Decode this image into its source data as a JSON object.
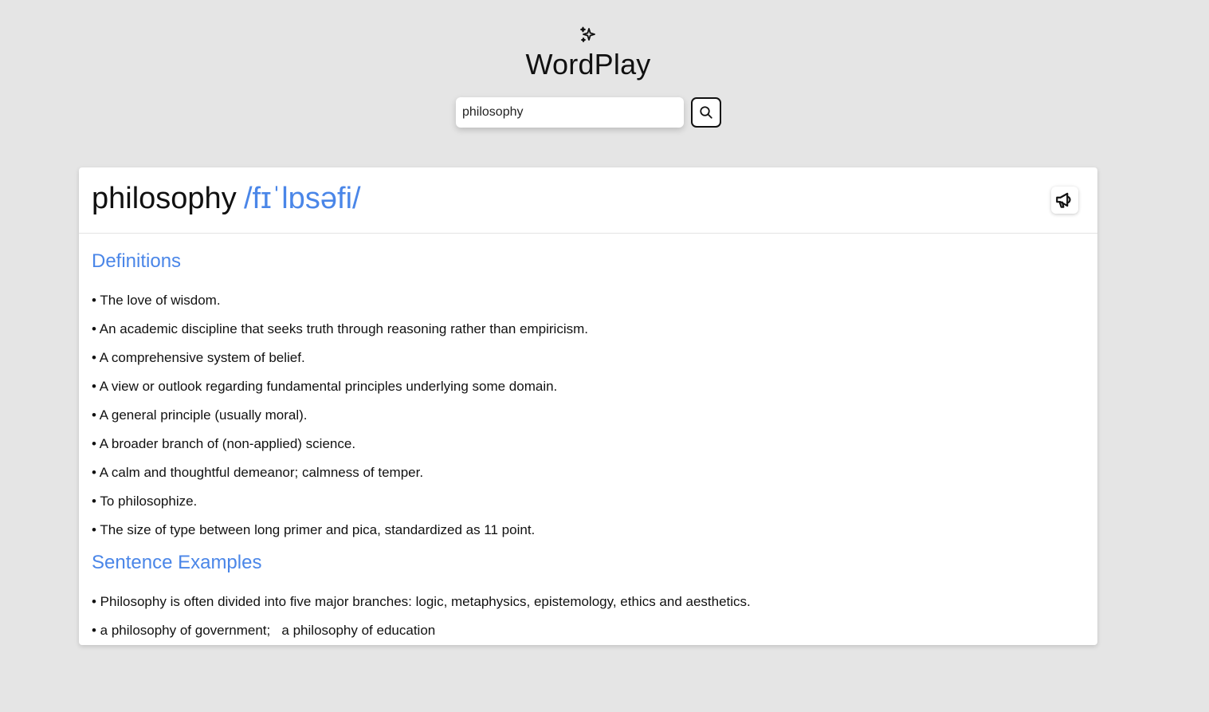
{
  "app": {
    "title": "WordPlay",
    "logo_icon": "sparkles-icon"
  },
  "search": {
    "value": "philosophy",
    "button_icon": "search-icon"
  },
  "entry": {
    "word": "philosophy",
    "phonetic": "/fɪˈlɒsəfi/",
    "audio_icon": "megaphone-icon",
    "definitions_heading": "Definitions",
    "definitions": [
      "• The love of wisdom.",
      "• An academic discipline that seeks truth through reasoning rather than empiricism.",
      "• A comprehensive system of belief.",
      "• A view or outlook regarding fundamental principles underlying some domain.",
      "• A general principle (usually moral).",
      "• A broader branch of (non-applied) science.",
      "• A calm and thoughtful demeanor; calmness of temper.",
      "• To philosophize.",
      "• The size of type between long primer and pica, standardized as 11 point."
    ],
    "examples_heading": "Sentence Examples",
    "examples": [
      "• Philosophy is often divided into five major branches: logic, metaphysics, epistemology, ethics and aesthetics.",
      "• a philosophy of government;   a philosophy of education"
    ]
  },
  "colors": {
    "accent": "#4a86e8",
    "background": "#e5e5e5",
    "card": "#ffffff"
  }
}
